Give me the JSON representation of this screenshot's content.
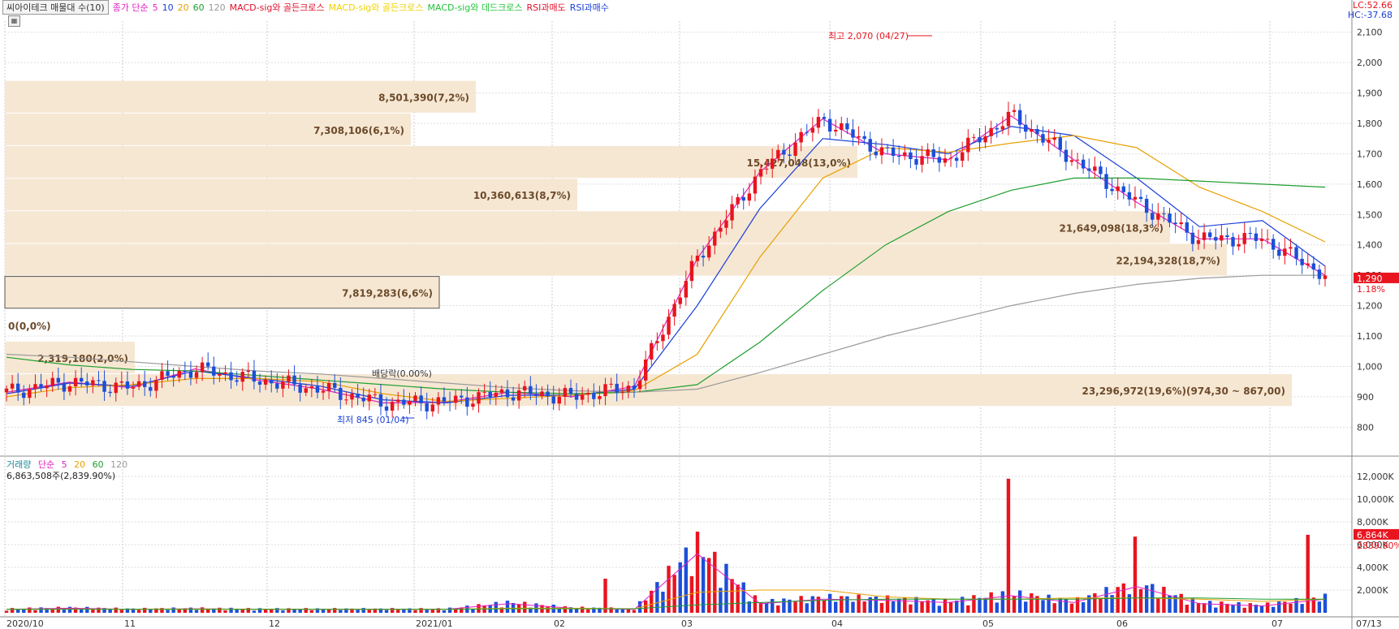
{
  "legend": {
    "title": "씨아이테크 매물대 수(10)",
    "ma_label": "종가 단순",
    "ma_periods": [
      {
        "label": "5",
        "color": "#e020c0"
      },
      {
        "label": "10",
        "color": "#1a3fd8"
      },
      {
        "label": "20",
        "color": "#e8a000"
      },
      {
        "label": "60",
        "color": "#1e9e2e"
      },
      {
        "label": "120",
        "color": "#9a9a9a"
      }
    ],
    "signals": [
      {
        "label": "MACD-sig와 골든크로스",
        "color": "#e0102a"
      },
      {
        "label": "MACD-sig와 골든크로스",
        "color": "#f2d200"
      },
      {
        "label": "MACD-sig와 데드크로스",
        "color": "#22c43a"
      },
      {
        "label": "RSI과매도",
        "color": "#e0102a"
      },
      {
        "label": "RSI과매수",
        "color": "#1a3fd8"
      }
    ]
  },
  "top_right": {
    "lc": "LC:52.66",
    "hc": "HC:-37.68"
  },
  "price_tag": {
    "value": "1,290",
    "pct": "1.18%"
  },
  "volume_tag": {
    "value": "6,864K",
    "pct": "2839.90%"
  },
  "volume_legend": {
    "title": "거래량",
    "ma_label": "단순",
    "periods": [
      {
        "label": "5",
        "color": "#e020c0"
      },
      {
        "label": "20",
        "color": "#e8a000"
      },
      {
        "label": "60",
        "color": "#1e9e2e"
      },
      {
        "label": "120",
        "color": "#9a9a9a"
      }
    ],
    "summary": "6,863,508주(2,839.90%)"
  },
  "colors": {
    "up": "#e8141e",
    "down": "#1c4fd8",
    "profile": "#f6e7d3",
    "grid": "#d8d8d8"
  },
  "chart_data": [
    {
      "type": "candlestick",
      "title": "씨아이테크 매물대 수(10)",
      "y_ticks": [
        "800",
        "900",
        "1,000",
        "1,100",
        "1,200",
        "1,300",
        "1,400",
        "1,500",
        "1,600",
        "1,700",
        "1,800",
        "1,900",
        "2,000",
        "2,100"
      ],
      "ylim": [
        710,
        2110
      ],
      "x_ticks": [
        "2020/10",
        "11",
        "12",
        "2021/01",
        "02",
        "03",
        "04",
        "05",
        "06",
        "07",
        "07/13"
      ],
      "grid": true,
      "annotations": {
        "high": "최고 2,070 (04/27)",
        "low": "최저 845 (01/04)",
        "dividend": "배당락(0.00%)"
      },
      "volume_profile": [
        {
          "label": "23,296,972(19,6%)(974,30 ~ 867,00)",
          "low": 867,
          "high": 974.3
        },
        {
          "label": "2,319,180(2,0%)",
          "low": 974.3,
          "high": 1081.6
        },
        {
          "label": "0(0,0%)",
          "low": 1081.6,
          "high": 1188.9
        },
        {
          "label": "7,819,283(6,6%)",
          "low": 1188.9,
          "high": 1296.2
        },
        {
          "label": "22,194,328(18,7%)",
          "low": 1296.2,
          "high": 1403.5
        },
        {
          "label": "21,649,098(18,3%)",
          "low": 1403.5,
          "high": 1510.8
        },
        {
          "label": "10,360,613(8,7%)",
          "low": 1510.8,
          "high": 1618.1
        },
        {
          "label": "15,427,048(13,0%)",
          "low": 1618.1,
          "high": 1725.4
        },
        {
          "label": "7,308,106(6,1%)",
          "low": 1725.4,
          "high": 1832.7
        },
        {
          "label": "8,501,390(7,2%)",
          "low": 1832.7,
          "high": 1940
        }
      ],
      "series": [
        {
          "name": "5",
          "values": [
            915,
            948,
            930,
            992,
            955,
            925,
            880,
            882,
            915,
            900,
            934,
            1355,
            1640,
            1815,
            1700,
            1680,
            1825,
            1680,
            1540,
            1420,
            1420,
            1300
          ]
        },
        {
          "name": "10",
          "values": [
            910,
            945,
            935,
            985,
            960,
            935,
            890,
            880,
            905,
            905,
            925,
            1200,
            1520,
            1750,
            1730,
            1700,
            1790,
            1760,
            1620,
            1460,
            1480,
            1330
          ]
        },
        {
          "name": "20",
          "values": [
            900,
            930,
            940,
            960,
            960,
            950,
            910,
            885,
            895,
            905,
            920,
            1040,
            1360,
            1620,
            1720,
            1705,
            1735,
            1760,
            1720,
            1590,
            1510,
            1410
          ]
        },
        {
          "name": "60",
          "values": [
            1030,
            1005,
            990,
            985,
            970,
            955,
            940,
            925,
            915,
            910,
            915,
            940,
            1080,
            1250,
            1400,
            1510,
            1580,
            1620,
            1620,
            1610,
            1600,
            1590
          ]
        },
        {
          "name": "120",
          "values": [
            1040,
            1030,
            1015,
            1000,
            985,
            975,
            960,
            945,
            930,
            920,
            915,
            925,
            980,
            1040,
            1100,
            1150,
            1200,
            1240,
            1270,
            1290,
            1300,
            1300
          ]
        }
      ]
    },
    {
      "type": "bar",
      "title": "거래량",
      "y_ticks": [
        "2,000K",
        "4,000K",
        "6,000K",
        "8,000K",
        "10,000K",
        "12,000K"
      ],
      "ylim": [
        0,
        12500
      ],
      "x_ticks": [
        "2020/10",
        "11",
        "12",
        "2021/01",
        "02",
        "03",
        "04",
        "05",
        "06",
        "07",
        "07/13"
      ],
      "series": [
        {
          "name": "volume",
          "peaks": [
            11800,
            6700,
            6864,
            3000
          ]
        },
        {
          "name": "5",
          "values": [
            300,
            400,
            300,
            350,
            300,
            300,
            300,
            300,
            800,
            400,
            300,
            5200,
            800,
            1200,
            1100,
            900,
            1500,
            900,
            2300,
            800,
            600,
            1200
          ]
        },
        {
          "name": "20",
          "values": [
            300,
            320,
            320,
            330,
            320,
            310,
            300,
            300,
            400,
            400,
            350,
            1800,
            2000,
            2000,
            1400,
            1200,
            1200,
            1300,
            1300,
            1200,
            1000,
            1200
          ]
        },
        {
          "name": "60",
          "values": [
            300,
            300,
            300,
            300,
            300,
            300,
            300,
            300,
            350,
            350,
            350,
            700,
            900,
            1100,
            1200,
            1200,
            1200,
            1200,
            1300,
            1300,
            1200,
            1200
          ]
        }
      ]
    }
  ]
}
